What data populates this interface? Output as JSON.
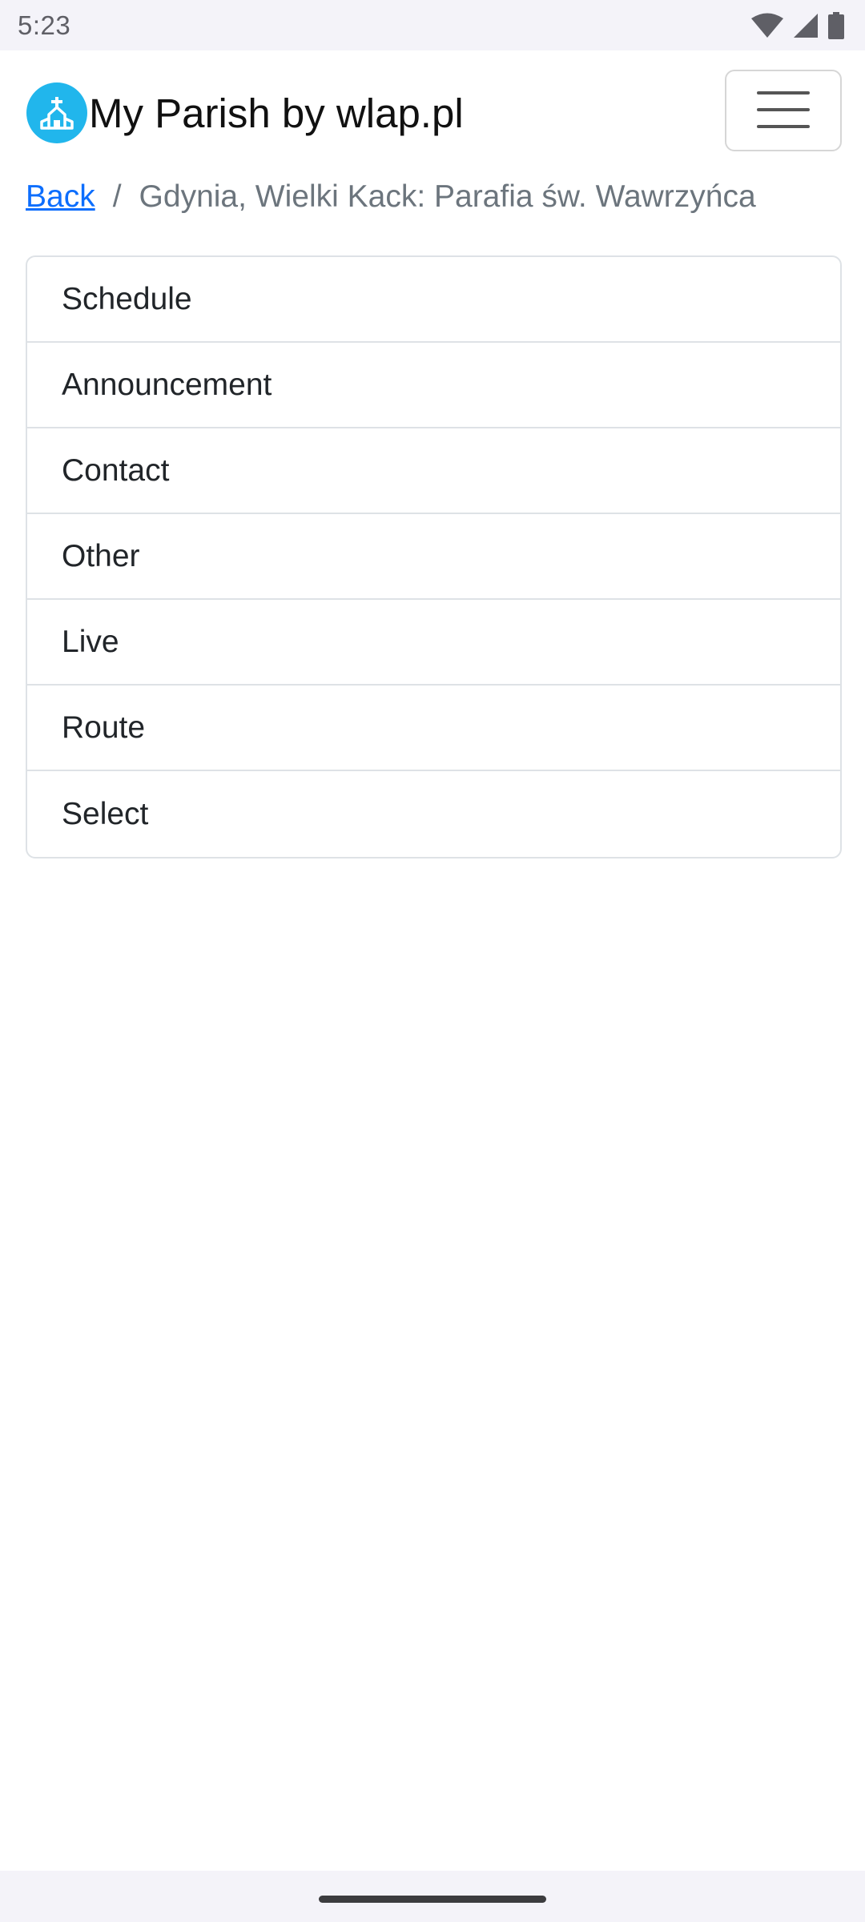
{
  "status_bar": {
    "time": "5:23",
    "icons": [
      "wifi-icon",
      "signal-icon",
      "battery-icon"
    ]
  },
  "header": {
    "brand_icon": "church-icon",
    "title": "My Parish by wlap.pl",
    "menu_icon": "hamburger-menu-icon"
  },
  "breadcrumb": {
    "back_label": "Back",
    "separator": "/",
    "current": "Gdynia, Wielki Kack: Parafia św. Wawrzyńca"
  },
  "menu": {
    "items": [
      {
        "label": "Schedule"
      },
      {
        "label": "Announcement"
      },
      {
        "label": "Contact"
      },
      {
        "label": "Other"
      },
      {
        "label": "Live"
      },
      {
        "label": "Route"
      },
      {
        "label": "Select"
      }
    ]
  },
  "colors": {
    "link": "#0d6efd",
    "brand_circle": "#21b6ec",
    "border": "#dee2e6"
  }
}
